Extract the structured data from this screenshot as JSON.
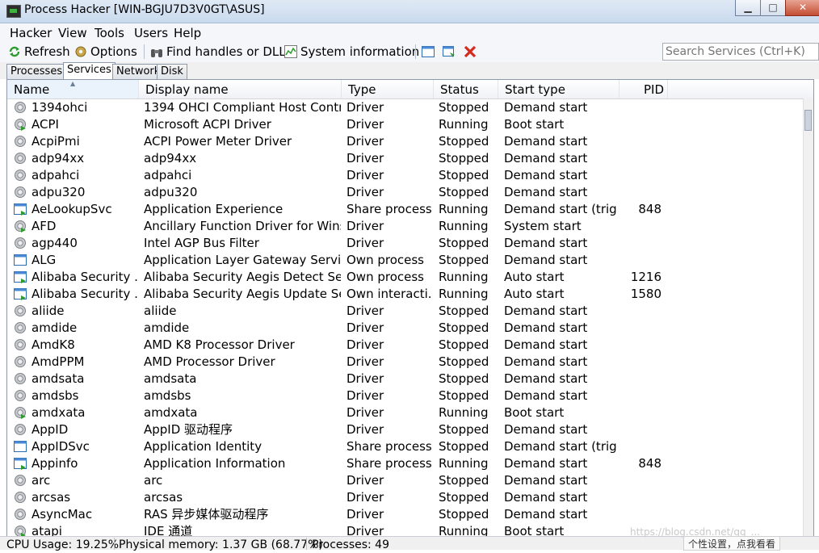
{
  "window": {
    "title": "Process Hacker [WIN-BGJU7D3V0GT\\ASUS]",
    "minimize": "▁",
    "maximize": "□",
    "close": "✕"
  },
  "menu": [
    "Hacker",
    "View",
    "Tools",
    "Users",
    "Help"
  ],
  "toolbar": {
    "refresh": "Refresh",
    "options": "Options",
    "find": "Find handles or DLLs",
    "sysinfo": "System information",
    "icons": [
      "window-icon",
      "switch-window-icon",
      "terminate-icon"
    ]
  },
  "search": {
    "placeholder": "Search Services (Ctrl+K)"
  },
  "tabs": [
    "Processes",
    "Services",
    "Network",
    "Disk"
  ],
  "columns": [
    "Name",
    "Display name",
    "Type",
    "Status",
    "Start type",
    "PID"
  ],
  "rows": [
    {
      "name": "1394ohci",
      "display": "1394 OHCI Compliant Host Contro...",
      "type": "Driver",
      "status": "Stopped",
      "start": "Demand start",
      "pid": "",
      "icon": "gear"
    },
    {
      "name": "ACPI",
      "display": "Microsoft ACPI Driver",
      "type": "Driver",
      "status": "Running",
      "start": "Boot start",
      "pid": "",
      "icon": "gear-run"
    },
    {
      "name": "AcpiPmi",
      "display": "ACPI Power Meter Driver",
      "type": "Driver",
      "status": "Stopped",
      "start": "Demand start",
      "pid": "",
      "icon": "gear"
    },
    {
      "name": "adp94xx",
      "display": "adp94xx",
      "type": "Driver",
      "status": "Stopped",
      "start": "Demand start",
      "pid": "",
      "icon": "gear"
    },
    {
      "name": "adpahci",
      "display": "adpahci",
      "type": "Driver",
      "status": "Stopped",
      "start": "Demand start",
      "pid": "",
      "icon": "gear"
    },
    {
      "name": "adpu320",
      "display": "adpu320",
      "type": "Driver",
      "status": "Stopped",
      "start": "Demand start",
      "pid": "",
      "icon": "gear"
    },
    {
      "name": "AeLookupSvc",
      "display": "Application Experience",
      "type": "Share process",
      "status": "Running",
      "start": "Demand start (trig...",
      "pid": "848",
      "icon": "win-run"
    },
    {
      "name": "AFD",
      "display": "Ancillary Function Driver for Winso...",
      "type": "Driver",
      "status": "Running",
      "start": "System start",
      "pid": "",
      "icon": "gear-run"
    },
    {
      "name": "agp440",
      "display": "Intel AGP Bus Filter",
      "type": "Driver",
      "status": "Stopped",
      "start": "Demand start",
      "pid": "",
      "icon": "gear"
    },
    {
      "name": "ALG",
      "display": "Application Layer Gateway Service",
      "type": "Own process",
      "status": "Stopped",
      "start": "Demand start",
      "pid": "",
      "icon": "win"
    },
    {
      "name": "Alibaba Security ...",
      "display": "Alibaba Security Aegis Detect Ser...",
      "type": "Own process",
      "status": "Running",
      "start": "Auto start",
      "pid": "1216",
      "icon": "win-run"
    },
    {
      "name": "Alibaba Security ...",
      "display": "Alibaba Security Aegis Update Ser...",
      "type": "Own interacti...",
      "status": "Running",
      "start": "Auto start",
      "pid": "1580",
      "icon": "win-run"
    },
    {
      "name": "aliide",
      "display": "aliide",
      "type": "Driver",
      "status": "Stopped",
      "start": "Demand start",
      "pid": "",
      "icon": "gear"
    },
    {
      "name": "amdide",
      "display": "amdide",
      "type": "Driver",
      "status": "Stopped",
      "start": "Demand start",
      "pid": "",
      "icon": "gear"
    },
    {
      "name": "AmdK8",
      "display": "AMD K8 Processor Driver",
      "type": "Driver",
      "status": "Stopped",
      "start": "Demand start",
      "pid": "",
      "icon": "gear"
    },
    {
      "name": "AmdPPM",
      "display": "AMD Processor Driver",
      "type": "Driver",
      "status": "Stopped",
      "start": "Demand start",
      "pid": "",
      "icon": "gear"
    },
    {
      "name": "amdsata",
      "display": "amdsata",
      "type": "Driver",
      "status": "Stopped",
      "start": "Demand start",
      "pid": "",
      "icon": "gear"
    },
    {
      "name": "amdsbs",
      "display": "amdsbs",
      "type": "Driver",
      "status": "Stopped",
      "start": "Demand start",
      "pid": "",
      "icon": "gear"
    },
    {
      "name": "amdxata",
      "display": "amdxata",
      "type": "Driver",
      "status": "Running",
      "start": "Boot start",
      "pid": "",
      "icon": "gear-run"
    },
    {
      "name": "AppID",
      "display": "AppID 驱动程序",
      "type": "Driver",
      "status": "Stopped",
      "start": "Demand start",
      "pid": "",
      "icon": "gear"
    },
    {
      "name": "AppIDSvc",
      "display": "Application Identity",
      "type": "Share process",
      "status": "Stopped",
      "start": "Demand start (trig...",
      "pid": "",
      "icon": "win"
    },
    {
      "name": "Appinfo",
      "display": "Application Information",
      "type": "Share process",
      "status": "Running",
      "start": "Demand start",
      "pid": "848",
      "icon": "win-run"
    },
    {
      "name": "arc",
      "display": "arc",
      "type": "Driver",
      "status": "Stopped",
      "start": "Demand start",
      "pid": "",
      "icon": "gear"
    },
    {
      "name": "arcsas",
      "display": "arcsas",
      "type": "Driver",
      "status": "Stopped",
      "start": "Demand start",
      "pid": "",
      "icon": "gear"
    },
    {
      "name": "AsyncMac",
      "display": "RAS 异步媒体驱动程序",
      "type": "Driver",
      "status": "Stopped",
      "start": "Demand start",
      "pid": "",
      "icon": "gear"
    },
    {
      "name": "atapi",
      "display": "IDE 通道",
      "type": "Driver",
      "status": "Running",
      "start": "Boot start",
      "pid": "",
      "icon": "gear-run"
    }
  ],
  "statusbar": {
    "cpu": "CPU Usage: 19.25%",
    "memory": "Physical memory: 1.37 GB (68.77%)",
    "processes": "Processes: 49"
  },
  "popup": "个性设置，点我看看",
  "watermark": "https://blog.csdn.net/qq_..."
}
